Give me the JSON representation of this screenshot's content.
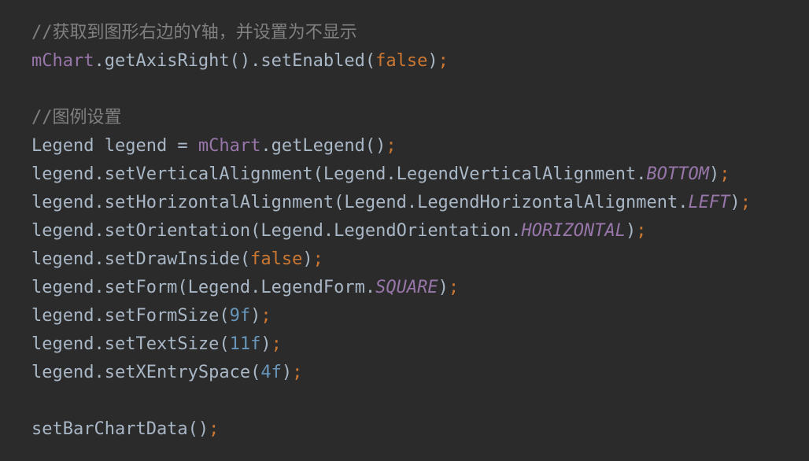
{
  "colors": {
    "background": "#2b2b2b",
    "plain": "#a9b7c6",
    "comment": "#808080",
    "field": "#9876aa",
    "keyword": "#cc7832",
    "number": "#6897bb"
  },
  "code": {
    "lines": [
      [
        {
          "t": "//获取到图形右边的Y轴，并设置为不显示",
          "k": "comment"
        }
      ],
      [
        {
          "t": "mChart",
          "k": "field"
        },
        {
          "t": ".getAxisRight().setEnabled(",
          "k": "plain"
        },
        {
          "t": "false",
          "k": "keyword"
        },
        {
          "t": ")",
          "k": "plain"
        },
        {
          "t": ";",
          "k": "punct"
        }
      ],
      [],
      [
        {
          "t": "//图例设置",
          "k": "comment"
        }
      ],
      [
        {
          "t": "Legend legend = ",
          "k": "plain"
        },
        {
          "t": "mChart",
          "k": "field"
        },
        {
          "t": ".getLegend()",
          "k": "plain"
        },
        {
          "t": ";",
          "k": "punct"
        }
      ],
      [
        {
          "t": "legend.setVerticalAlignment(Legend.LegendVerticalAlignment.",
          "k": "plain"
        },
        {
          "t": "BOTTOM",
          "k": "field-italic"
        },
        {
          "t": ")",
          "k": "plain"
        },
        {
          "t": ";",
          "k": "punct"
        }
      ],
      [
        {
          "t": "legend.setHorizontalAlignment(Legend.LegendHorizontalAlignment.",
          "k": "plain"
        },
        {
          "t": "LEFT",
          "k": "field-italic"
        },
        {
          "t": ")",
          "k": "plain"
        },
        {
          "t": ";",
          "k": "punct"
        }
      ],
      [
        {
          "t": "legend.setOrientation(Legend.LegendOrientation.",
          "k": "plain"
        },
        {
          "t": "HORIZONTAL",
          "k": "field-italic"
        },
        {
          "t": ")",
          "k": "plain"
        },
        {
          "t": ";",
          "k": "punct"
        }
      ],
      [
        {
          "t": "legend.setDrawInside(",
          "k": "plain"
        },
        {
          "t": "false",
          "k": "keyword"
        },
        {
          "t": ")",
          "k": "plain"
        },
        {
          "t": ";",
          "k": "punct"
        }
      ],
      [
        {
          "t": "legend.setForm(Legend.LegendForm.",
          "k": "plain"
        },
        {
          "t": "SQUARE",
          "k": "field-italic"
        },
        {
          "t": ")",
          "k": "plain"
        },
        {
          "t": ";",
          "k": "punct"
        }
      ],
      [
        {
          "t": "legend.setFormSize(",
          "k": "plain"
        },
        {
          "t": "9f",
          "k": "number"
        },
        {
          "t": ")",
          "k": "plain"
        },
        {
          "t": ";",
          "k": "punct"
        }
      ],
      [
        {
          "t": "legend.setTextSize(",
          "k": "plain"
        },
        {
          "t": "11f",
          "k": "number"
        },
        {
          "t": ")",
          "k": "plain"
        },
        {
          "t": ";",
          "k": "punct"
        }
      ],
      [
        {
          "t": "legend.setXEntrySpace(",
          "k": "plain"
        },
        {
          "t": "4f",
          "k": "number"
        },
        {
          "t": ")",
          "k": "plain"
        },
        {
          "t": ";",
          "k": "punct"
        }
      ],
      [],
      [
        {
          "t": "setBarChartData()",
          "k": "plain"
        },
        {
          "t": ";",
          "k": "punct"
        }
      ]
    ]
  }
}
